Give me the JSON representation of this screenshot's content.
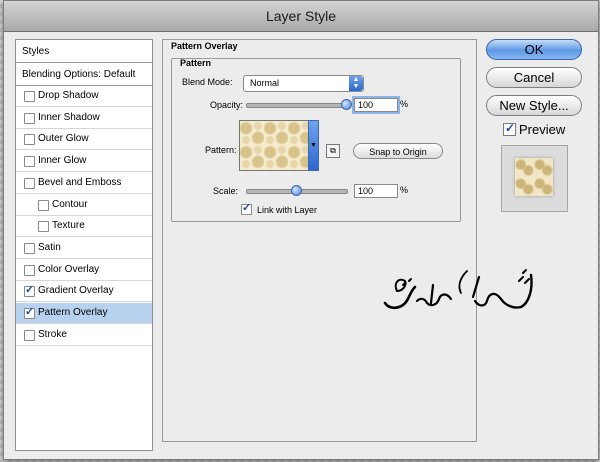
{
  "window": {
    "title": "Layer Style"
  },
  "sidebar": {
    "header": "Styles",
    "blending": "Blending Options: Default",
    "items": [
      {
        "label": "Drop Shadow",
        "checked": false,
        "indent": false,
        "selected": false
      },
      {
        "label": "Inner Shadow",
        "checked": false,
        "indent": false,
        "selected": false
      },
      {
        "label": "Outer Glow",
        "checked": false,
        "indent": false,
        "selected": false
      },
      {
        "label": "Inner Glow",
        "checked": false,
        "indent": false,
        "selected": false
      },
      {
        "label": "Bevel and Emboss",
        "checked": false,
        "indent": false,
        "selected": false
      },
      {
        "label": "Contour",
        "checked": false,
        "indent": true,
        "selected": false
      },
      {
        "label": "Texture",
        "checked": false,
        "indent": true,
        "selected": false
      },
      {
        "label": "Satin",
        "checked": false,
        "indent": false,
        "selected": false
      },
      {
        "label": "Color Overlay",
        "checked": false,
        "indent": false,
        "selected": false
      },
      {
        "label": "Gradient Overlay",
        "checked": true,
        "indent": false,
        "selected": false
      },
      {
        "label": "Pattern Overlay",
        "checked": true,
        "indent": false,
        "selected": true
      },
      {
        "label": "Stroke",
        "checked": false,
        "indent": false,
        "selected": false
      }
    ]
  },
  "pattern_overlay": {
    "group_title": "Pattern Overlay",
    "subgroup_title": "Pattern",
    "blend_mode_label": "Blend Mode:",
    "blend_mode_value": "Normal",
    "opacity_label": "Opacity:",
    "opacity_value": "100",
    "opacity_level": 1.0,
    "pattern_label": "Pattern:",
    "snap_button": "Snap to Origin",
    "scale_label": "Scale:",
    "scale_value": "100",
    "scale_level": 0.5,
    "percent": "%",
    "link_label": "Link with Layer",
    "link_checked": true
  },
  "buttons": {
    "ok": "OK",
    "cancel": "Cancel",
    "new_style": "New Style...",
    "preview_label": "Preview",
    "preview_checked": true
  },
  "watermark": {
    "text": "شرکت سارگون"
  },
  "colors": {
    "selected_row": "#b6d2ee",
    "accent": "#2b67cf"
  }
}
